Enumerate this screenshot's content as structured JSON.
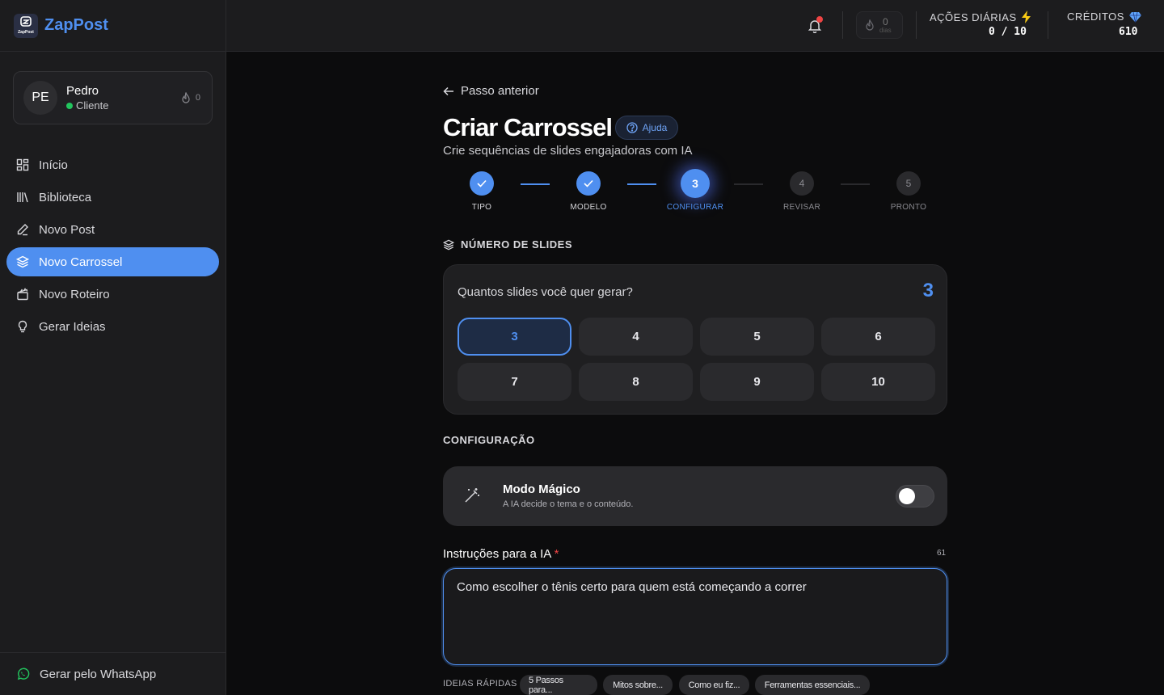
{
  "brand": {
    "name": "ZapPost",
    "mini": "ZapPost"
  },
  "user": {
    "initials": "PE",
    "name": "Pedro",
    "role": "Cliente",
    "streak": "0"
  },
  "nav": [
    {
      "label": "Início",
      "icon": "grid-icon"
    },
    {
      "label": "Biblioteca",
      "icon": "library-icon"
    },
    {
      "label": "Novo Post",
      "icon": "pen-icon"
    },
    {
      "label": "Novo Carrossel",
      "icon": "layers-icon",
      "active": true
    },
    {
      "label": "Novo Roteiro",
      "icon": "clapperboard-icon"
    },
    {
      "label": "Gerar Ideias",
      "icon": "lightbulb-icon"
    }
  ],
  "whatsapp": {
    "label": "Gerar pelo WhatsApp"
  },
  "topbar": {
    "days_value": "0",
    "days_label": "dias",
    "daily_actions_label": "AÇÕES DIÁRIAS",
    "daily_actions_value": "0 / 10",
    "credits_label": "CRÉDITOS",
    "credits_value": "610"
  },
  "page": {
    "back_label": "Passo anterior",
    "title": "Criar Carrossel",
    "help_label": "Ajuda",
    "subtitle": "Crie sequências de slides engajadoras com IA"
  },
  "steps": [
    {
      "label": "TIPO",
      "number": "1",
      "state": "done"
    },
    {
      "label": "MODELO",
      "number": "2",
      "state": "done"
    },
    {
      "label": "CONFIGURAR",
      "number": "3",
      "state": "current"
    },
    {
      "label": "REVISAR",
      "number": "4",
      "state": "todo"
    },
    {
      "label": "PRONTO",
      "number": "5",
      "state": "todo"
    }
  ],
  "slides": {
    "section_title": "NÚMERO DE SLIDES",
    "question": "Quantos slides você quer gerar?",
    "selected": "3",
    "options": [
      "3",
      "4",
      "5",
      "6",
      "7",
      "8",
      "9",
      "10"
    ]
  },
  "config": {
    "section_title": "CONFIGURAÇÃO",
    "magic_title": "Modo Mágico",
    "magic_desc": "A IA decide o tema e o conteúdo.",
    "magic_enabled": false
  },
  "instructions": {
    "label": "Instruções para a IA",
    "required_mark": "*",
    "char_count": "61",
    "value": "Como escolher o tênis certo para quem está começando a correr"
  },
  "quick_ideas": {
    "label": "IDEIAS RÁPIDAS",
    "chips": [
      "5 Passos para...",
      "Mitos sobre...",
      "Como eu fiz...",
      "Ferramentas essenciais..."
    ]
  },
  "colors": {
    "accent": "#4f8ff0",
    "background": "#0c0c0d",
    "panel": "#1c1c1e",
    "danger": "#ef4444",
    "online": "#22c55e"
  }
}
